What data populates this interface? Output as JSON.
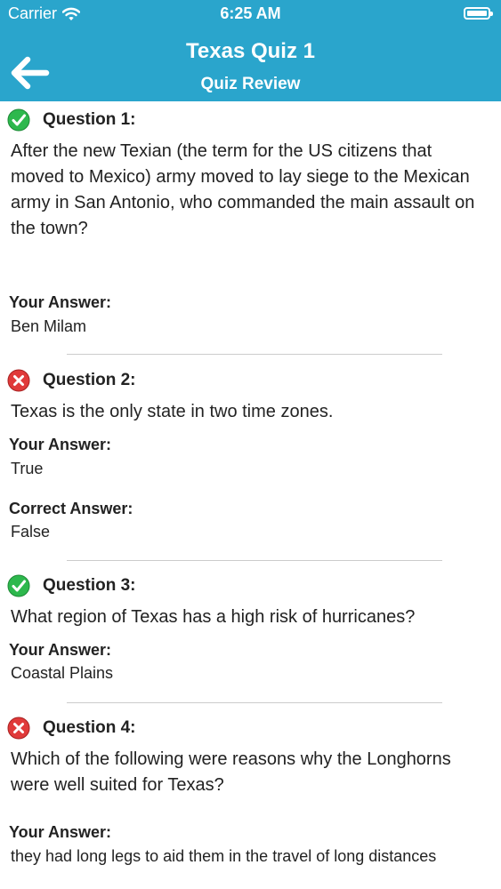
{
  "status_bar": {
    "carrier": "Carrier",
    "time": "6:25 AM"
  },
  "nav": {
    "title": "Texas Quiz 1",
    "subtitle": "Quiz Review"
  },
  "colors": {
    "header": "#2aa5cc",
    "correct": "#2db84d",
    "incorrect": "#e03a3a"
  },
  "labels": {
    "your_answer": "Your Answer:",
    "correct_answer": "Correct Answer:"
  },
  "questions": [
    {
      "label": "Question 1:",
      "status": "correct",
      "text": "After the new Texian (the term for the US citizens that moved to Mexico) army moved to lay siege to the Mexican army in San Antonio, who commanded the main assault on the town?",
      "your_answer": "Ben Milam"
    },
    {
      "label": "Question 2:",
      "status": "incorrect",
      "text": "Texas is the only state in two time zones.",
      "your_answer": "True",
      "correct_answer": "False"
    },
    {
      "label": "Question 3:",
      "status": "correct",
      "text": "What region of Texas has a high risk of hurricanes?",
      "your_answer": "Coastal Plains"
    },
    {
      "label": "Question 4:",
      "status": "incorrect",
      "text": "Which of the following were reasons why the Longhorns were well suited for Texas?",
      "your_answer": "they had long legs to aid them in the travel of long distances"
    }
  ]
}
